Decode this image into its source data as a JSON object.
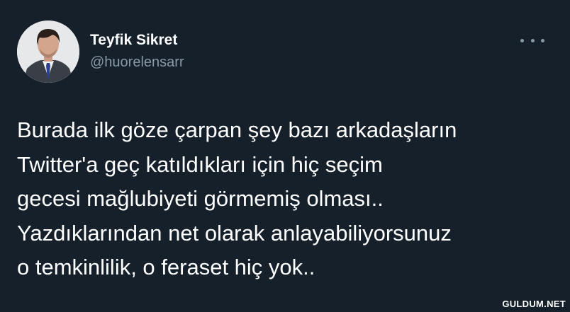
{
  "tweet": {
    "author": {
      "display_name": "Teyfik Sikret",
      "handle": "@huorelensarr"
    },
    "more_icon": "more-horizontal-icon",
    "text_lines": [
      "Burada ilk göze çarpan şey bazı arkadaşların",
      "Twitter'a geç katıldıkları için hiç seçim",
      "gecesi mağlubiyeti görmemiş olması..",
      "Yazdıklarından net olarak anlayabiliyorsunuz",
      "o temkinlilik, o feraset hiç yok.."
    ]
  },
  "watermark": "GULDUM.NET",
  "colors": {
    "background": "#15202b",
    "text": "#ffffff",
    "secondary_text": "#8899a6"
  }
}
